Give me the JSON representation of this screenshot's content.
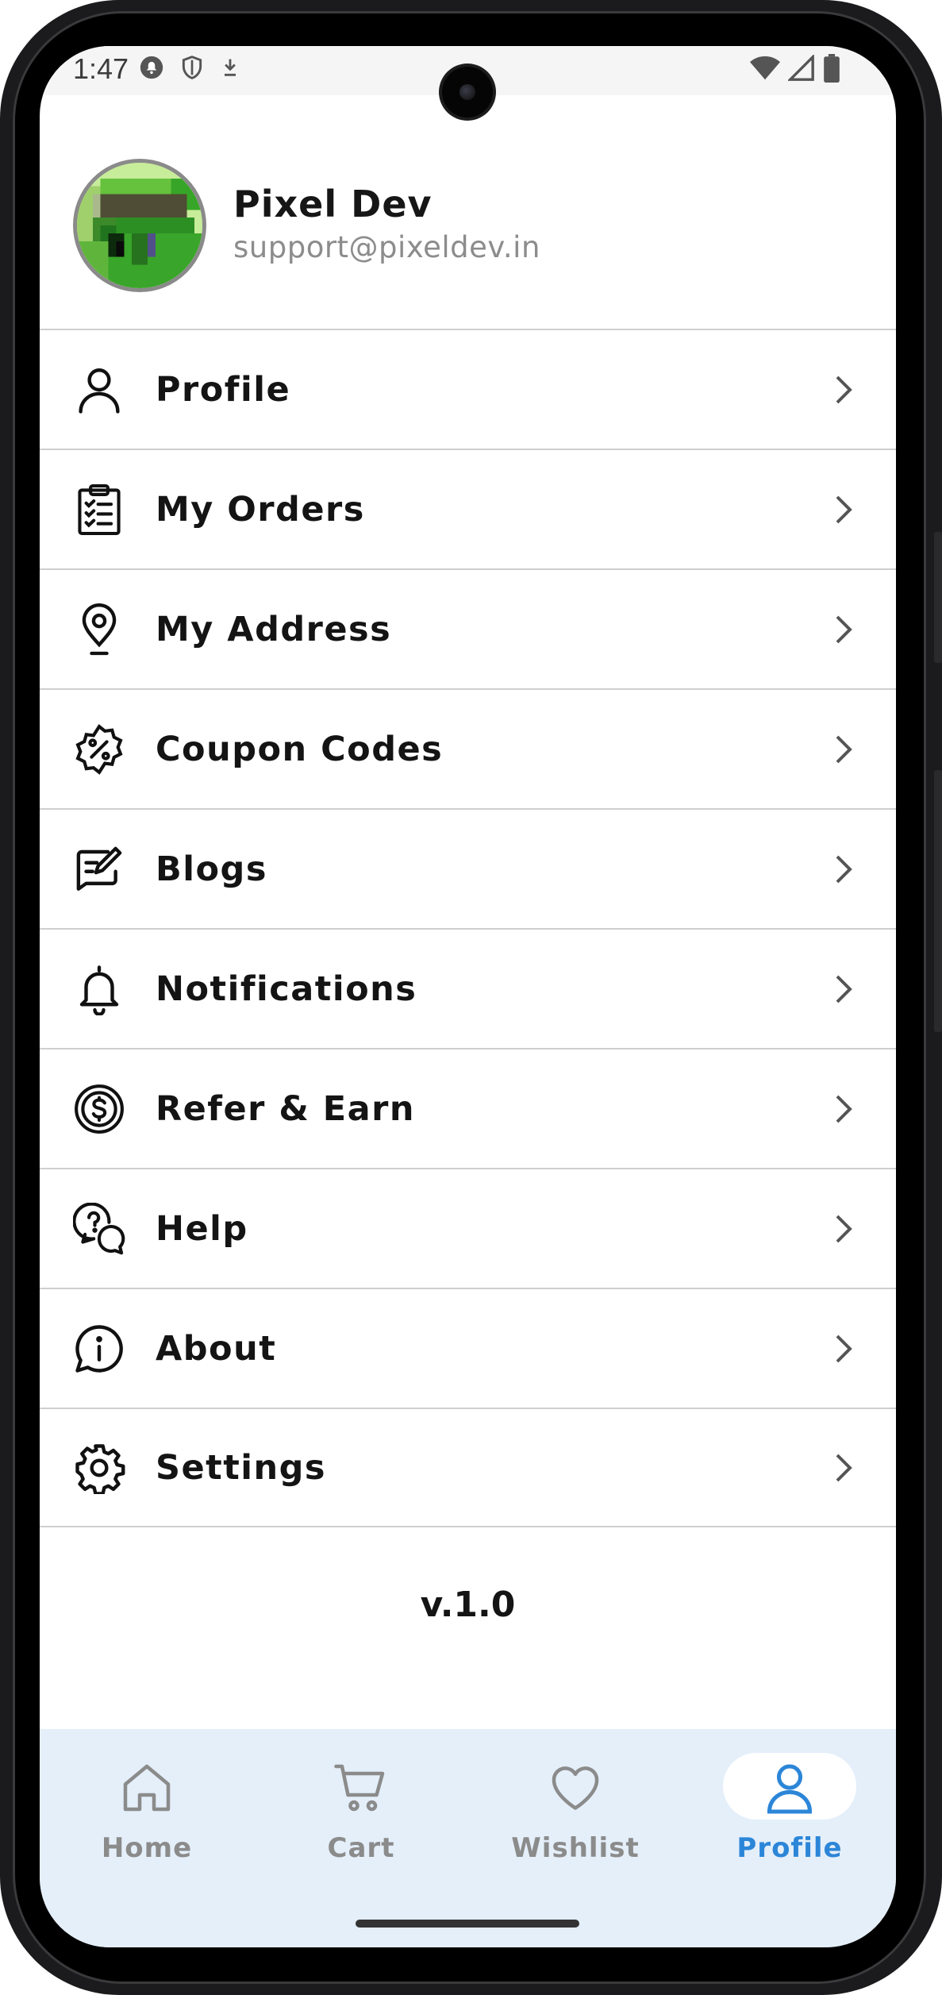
{
  "status": {
    "time": "1:47"
  },
  "user": {
    "name": "Pixel Dev",
    "email": "support@pixeldev.in"
  },
  "menu": [
    {
      "label": "Profile",
      "icon": "person-icon"
    },
    {
      "label": "My Orders",
      "icon": "clipboard-list-icon"
    },
    {
      "label": "My Address",
      "icon": "location-pin-icon"
    },
    {
      "label": "Coupon Codes",
      "icon": "discount-badge-icon"
    },
    {
      "label": "Blogs",
      "icon": "edit-note-icon"
    },
    {
      "label": "Notifications",
      "icon": "bell-icon"
    },
    {
      "label": "Refer & Earn",
      "icon": "dollar-coin-icon"
    },
    {
      "label": "Help",
      "icon": "help-chat-icon"
    },
    {
      "label": "About",
      "icon": "info-chat-icon"
    },
    {
      "label": "Settings",
      "icon": "gear-icon"
    }
  ],
  "version": "v.1.0",
  "nav": [
    {
      "label": "Home",
      "icon": "home-icon",
      "active": false
    },
    {
      "label": "Cart",
      "icon": "cart-icon",
      "active": false
    },
    {
      "label": "Wishlist",
      "icon": "heart-icon",
      "active": false
    },
    {
      "label": "Profile",
      "icon": "person-icon",
      "active": true
    }
  ],
  "colors": {
    "accent": "#2c86d8",
    "nav_background": "#e4effa",
    "inactive": "#8b8b8b"
  }
}
